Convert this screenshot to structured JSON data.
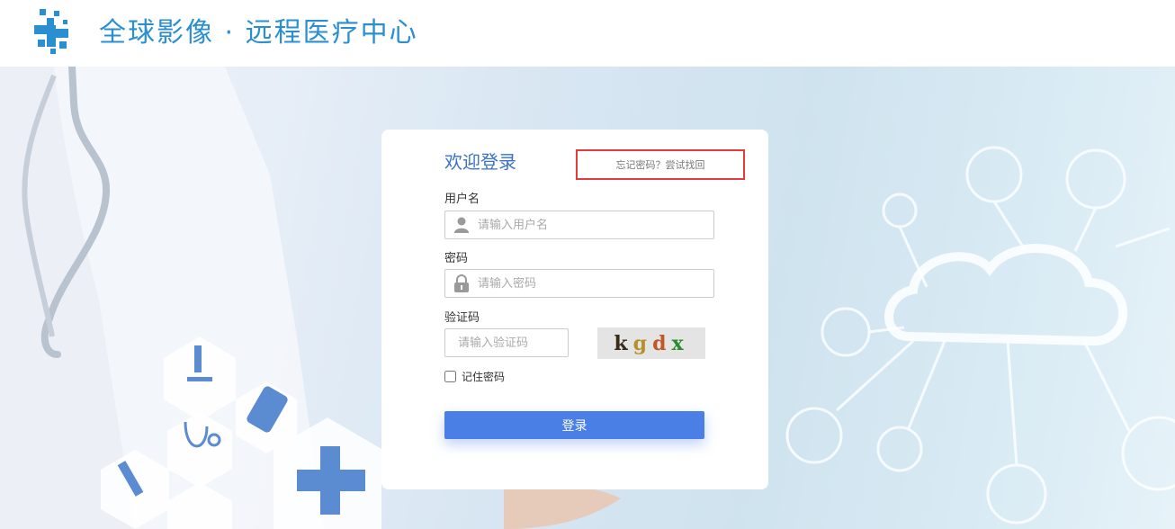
{
  "header": {
    "logo_text": "全球影像 · 远程医疗中心"
  },
  "login": {
    "title": "欢迎登录",
    "forgot_link": "忘记密码？尝试找回",
    "username_label": "用户名",
    "username_placeholder": "请输入用户名",
    "password_label": "密码",
    "password_placeholder": "请输入密码",
    "code_label": "验证码",
    "code_placeholder": "请输入验证码",
    "captcha_chars": [
      "k",
      "g",
      "d",
      "x"
    ],
    "captcha_colors": [
      "#3a2a1a",
      "#b8902a",
      "#c0592a",
      "#2e8a2e"
    ],
    "remember_label": "记住密码",
    "remember_checked": false,
    "submit_label": "登录"
  },
  "colors": {
    "brand": "#2a8fd0",
    "button": "#4a7fe6",
    "highlight_border": "#e33b3b"
  },
  "icons": [
    "user-icon",
    "lock-icon"
  ]
}
